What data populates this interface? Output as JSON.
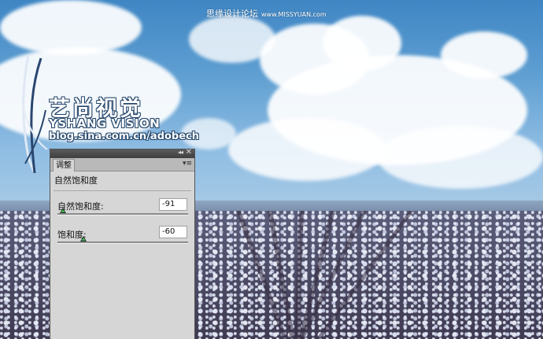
{
  "watermark": {
    "site_cn": "思缘设计论坛",
    "site_url": "www.MISSYUAN.com",
    "logo_cn": "艺尚视觉",
    "logo_en": "YSHANG VISION",
    "logo_url": "blog.sina.com.cn/adobech"
  },
  "panel": {
    "collapse_glyph": "◂◂",
    "close_glyph": "✕",
    "menu_glyph": "▾≡",
    "tab_label": "调整",
    "title": "自然饱和度",
    "rows": [
      {
        "label": "自然饱和度:",
        "value": "-91",
        "fraction": 0.045
      },
      {
        "label": "饱和度:",
        "value": "-60",
        "fraction": 0.2
      }
    ]
  }
}
